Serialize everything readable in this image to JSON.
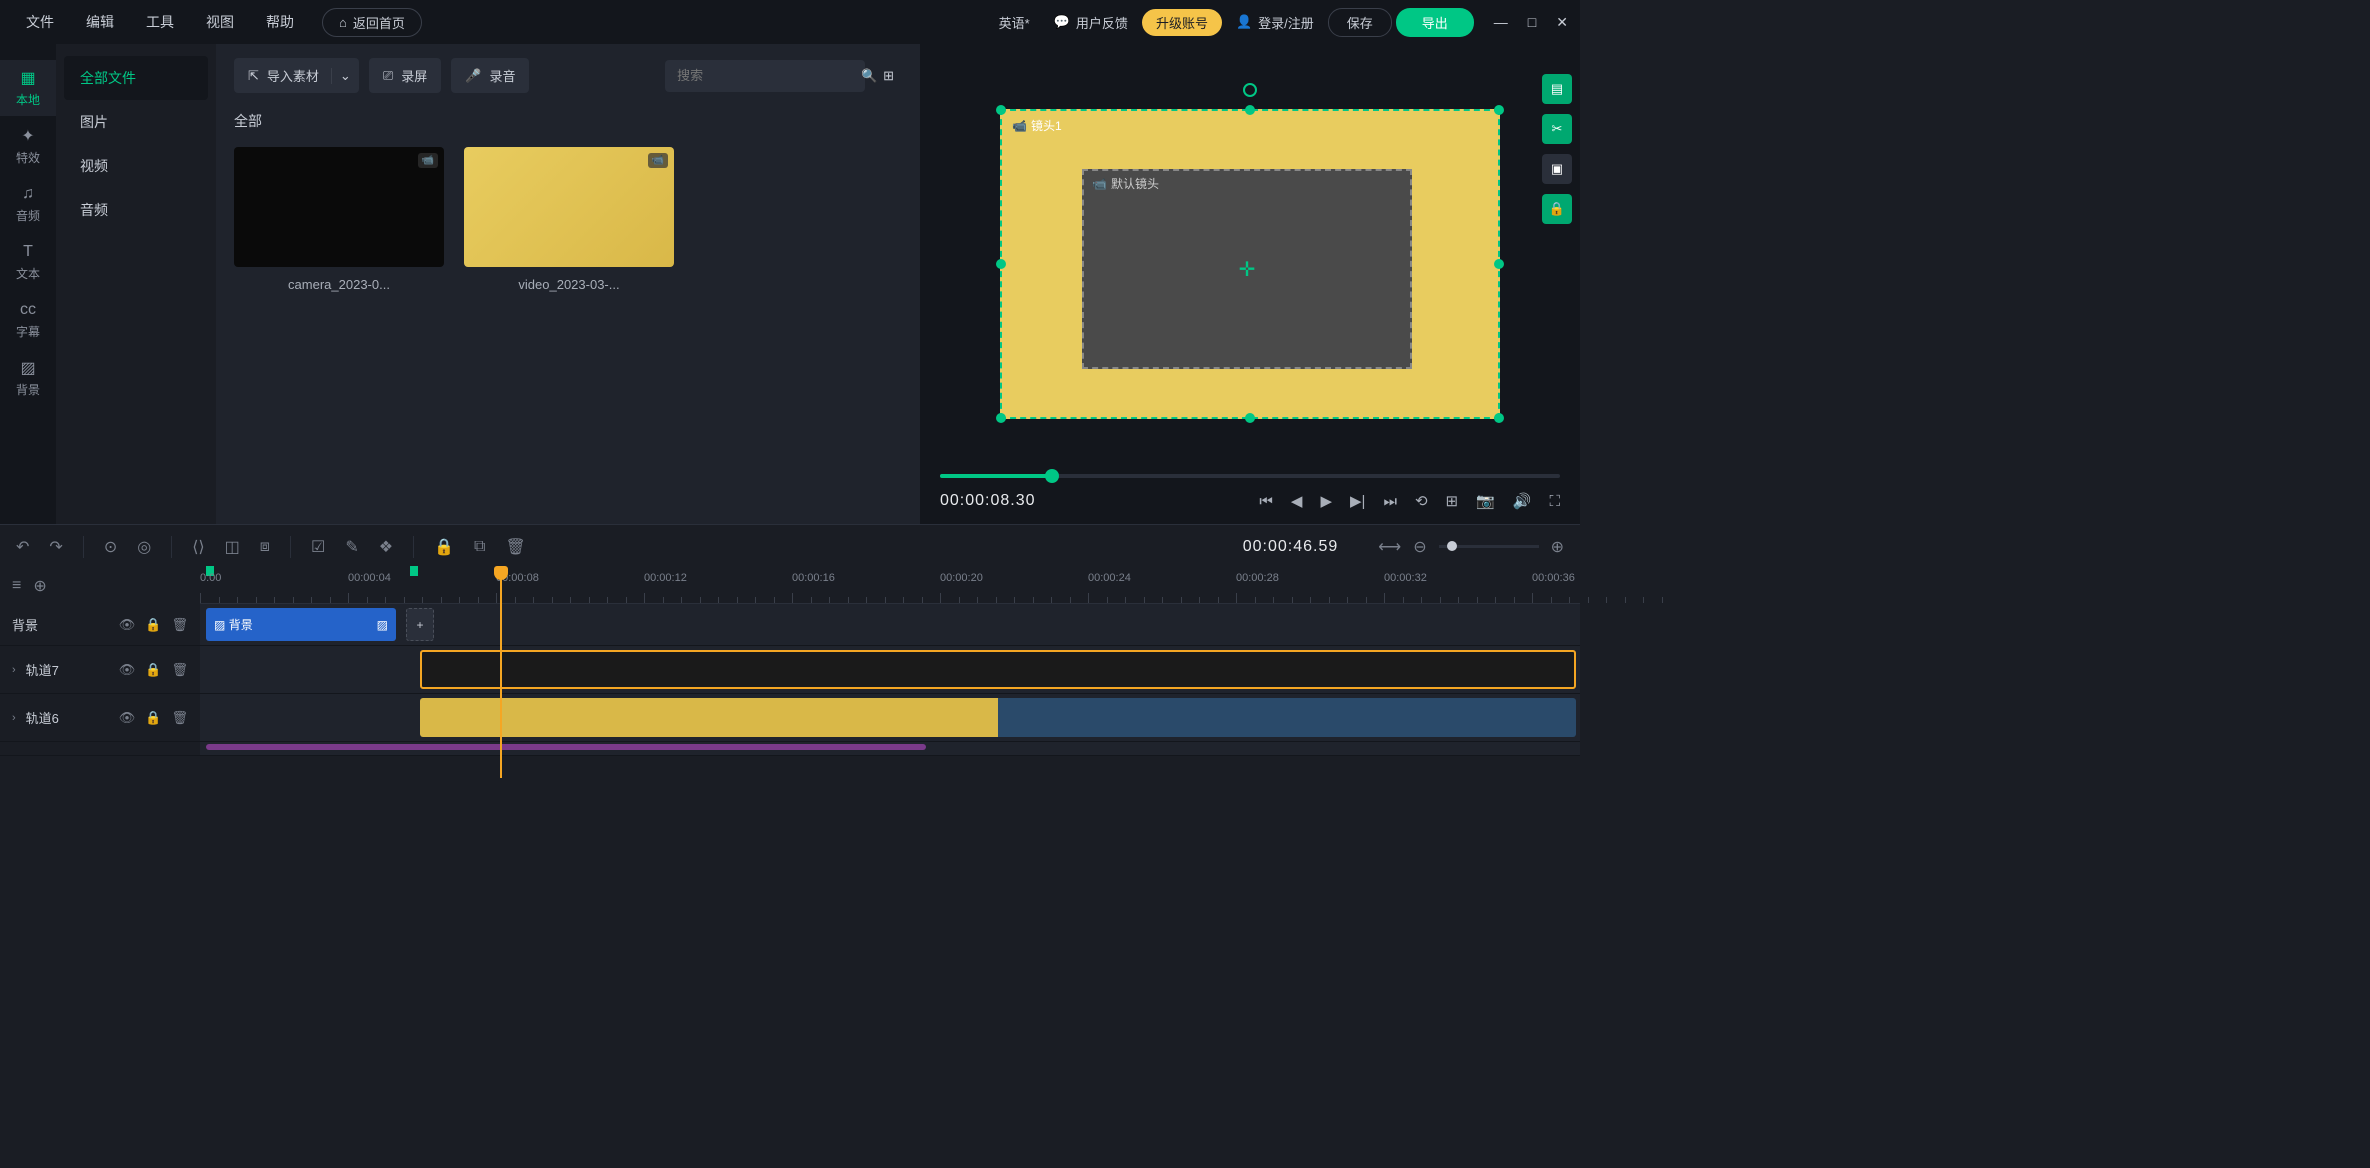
{
  "menubar": {
    "file": "文件",
    "edit": "编辑",
    "tools": "工具",
    "view": "视图",
    "help": "帮助",
    "home": "返回首页",
    "project": "英语*",
    "feedback": "用户反馈",
    "upgrade": "升级账号",
    "login": "登录/注册",
    "save": "保存",
    "export": "导出"
  },
  "sidebar": {
    "local": "本地",
    "effects": "特效",
    "audio": "音频",
    "text": "文本",
    "caption": "字幕",
    "background": "背景"
  },
  "categories": {
    "all": "全部文件",
    "image": "图片",
    "video": "视频",
    "audio": "音频"
  },
  "toolbar": {
    "import": "导入素材",
    "record_screen": "录屏",
    "record_audio": "录音",
    "search_placeholder": "搜索"
  },
  "section_label": "全部",
  "media": [
    {
      "name": "camera_2023-0..."
    },
    {
      "name": "video_2023-03-..."
    }
  ],
  "preview": {
    "outer_label": "镜头1",
    "inner_label": "默认镜头",
    "time": "00:00:08.30"
  },
  "timeline": {
    "time": "00:00:46.59",
    "ticks": [
      "0:00",
      "00:00:04",
      "00:00:08",
      "00:00:12",
      "00:00:16",
      "00:00:20",
      "00:00:24",
      "00:00:28",
      "00:00:32",
      "00:00:36"
    ],
    "track_bg": "背景",
    "track7": "轨道7",
    "track6": "轨道6",
    "bg_clip_label": "背景"
  }
}
